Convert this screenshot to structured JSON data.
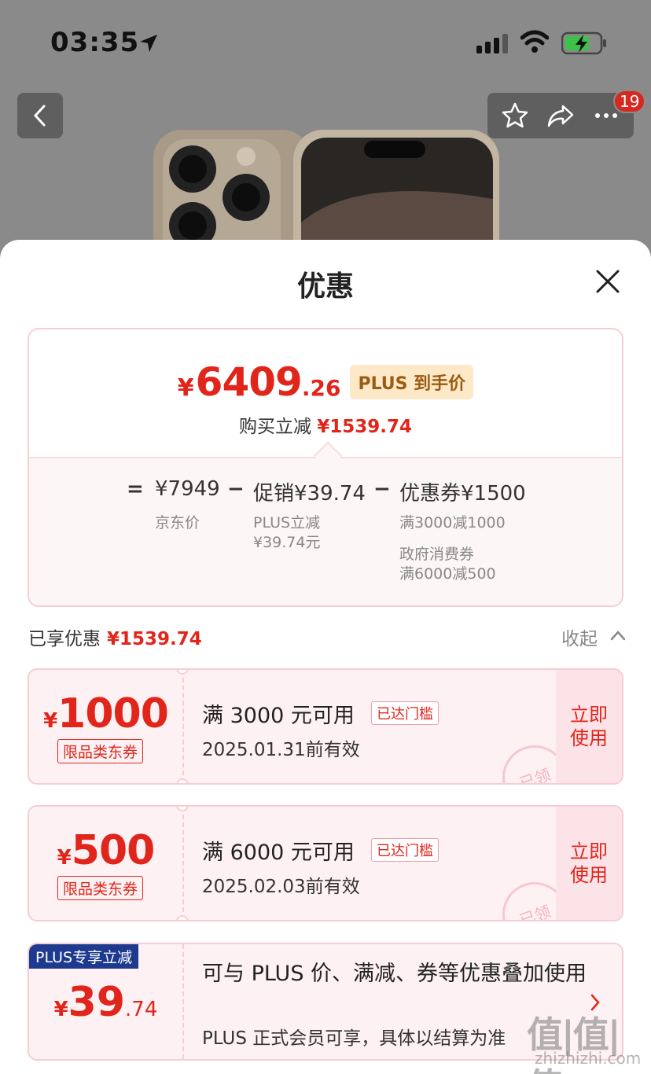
{
  "status_bar": {
    "time": "03:35"
  },
  "nav": {
    "badge_count": "19"
  },
  "sheet": {
    "title": "优惠",
    "summary": {
      "price_yen": "¥",
      "price_int": "6409",
      "price_dec": ".26",
      "plus_tag": "PLUS 到手价",
      "save_label": "购买立减",
      "save_value": "¥1539.74",
      "calc": {
        "eq": "=",
        "minus": "−",
        "jd_price": "¥7949",
        "jd_price_label": "京东价",
        "promo": "促销¥39.74",
        "promo_sub1": "PLUS立减",
        "promo_sub2": "¥39.74元",
        "coupon": "优惠券¥1500",
        "coupon_sub1": "满3000减1000",
        "coupon_sub2": "政府消费券",
        "coupon_sub3": "满6000减500"
      }
    },
    "enjoyed_label": "已享优惠",
    "enjoyed_value": "¥1539.74",
    "collapse_label": "收起",
    "coupons": [
      {
        "yen": "¥",
        "amount": "1000",
        "tag": "限品类东券",
        "condition": "满 3000 元可用",
        "reached": "已达门槛",
        "expire": "2025.01.31前有效",
        "use": "立即使用",
        "stamp": "已领"
      },
      {
        "yen": "¥",
        "amount": "500",
        "tag": "限品类东券",
        "condition": "满 6000 元可用",
        "reached": "已达门槛",
        "expire": "2025.02.03前有效",
        "use": "立即使用",
        "stamp": "已领"
      }
    ],
    "plus_card": {
      "label": "PLUS专享立减",
      "yen": "¥",
      "amount_int": "39",
      "amount_dec": ".74",
      "desc": "可与 PLUS 价、满减、券等优惠叠加使用",
      "note": "PLUS 正式会员可享，具体以结算为准"
    }
  },
  "watermark": {
    "logo": "值|值|值",
    "site": "zhizhizhi.com"
  },
  "colors": {
    "accent_red": "#e1251b",
    "plus_blue": "#1e3a8f"
  }
}
